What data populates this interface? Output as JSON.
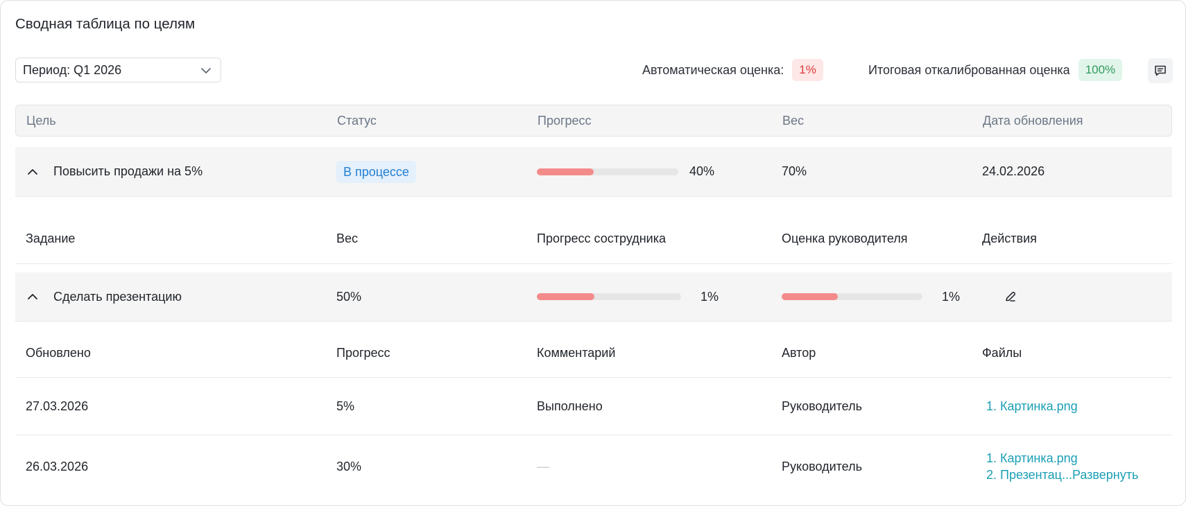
{
  "page": {
    "title": "Сводная таблица по целям"
  },
  "period": {
    "label": "Период: Q1 2026"
  },
  "scores": {
    "auto_label": "Автоматическая оценка:",
    "auto_value": "1%",
    "final_label": "Итоговая откалиброванная оценка",
    "final_value": "100%"
  },
  "colors": {
    "accent_link": "#1a9fb5",
    "progress_fill": "#f48b8b",
    "status_badge_bg": "#e4f0fb"
  },
  "goals_table": {
    "headers": {
      "goal": "Цель",
      "status": "Статус",
      "progress": "Прогресс",
      "weight": "Вес",
      "updated": "Дата обновления"
    },
    "goal": {
      "name": "Повысить продажи на 5%",
      "status": "В процессе",
      "progress_label": "40%",
      "progress_fill": 0.4,
      "weight": "70%",
      "updated": "24.02.2026"
    }
  },
  "tasks_table": {
    "headers": {
      "task": "Задание",
      "weight": "Вес",
      "employee_progress": "Прогресс сострудника",
      "manager_score": "Оценка руководителя",
      "actions": "Действия"
    },
    "task": {
      "name": "Сделать презентацию",
      "weight": "50%",
      "employee_progress_label": "1%",
      "employee_progress_fill": 0.4,
      "manager_score_label": "1%",
      "manager_score_fill": 0.4
    }
  },
  "updates_table": {
    "headers": {
      "updated": "Обновлено",
      "progress": "Прогресс",
      "comment": "Комментарий",
      "author": "Автор",
      "files": "Файлы"
    },
    "rows": [
      {
        "date": "27.03.2026",
        "progress": "5%",
        "comment": "Выполнено",
        "author": "Руководитель",
        "files": [
          "1. Картинка.png"
        ]
      },
      {
        "date": "26.03.2026",
        "progress": "30%",
        "comment": "—",
        "author": "Руководитель",
        "files": [
          "1. Картинка.png",
          "2. Презентац...Развернуть"
        ]
      }
    ]
  },
  "icons": {
    "period_chevron": "chevron-down-icon",
    "comment": "comment-icon",
    "collapse": "chevron-up-icon",
    "edit": "pencil-icon"
  }
}
